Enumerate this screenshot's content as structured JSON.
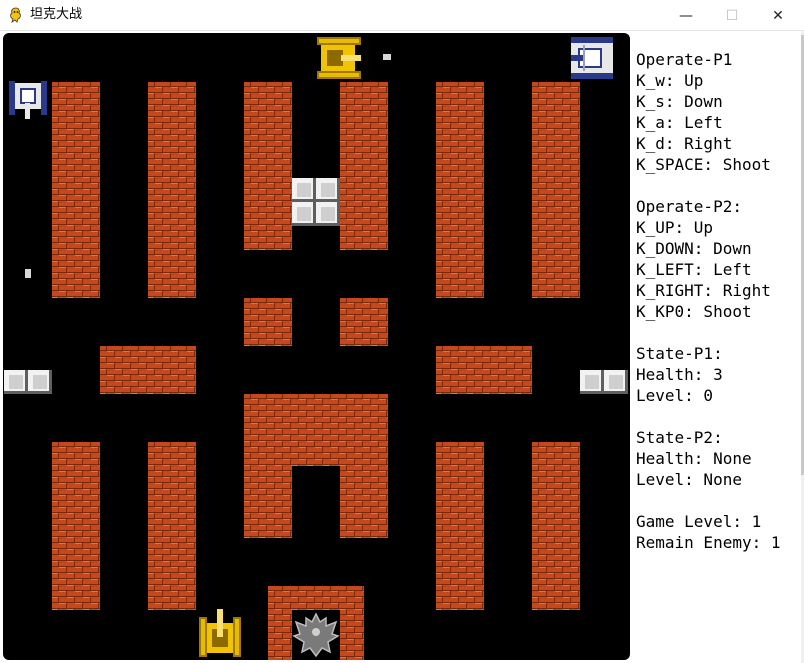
{
  "window": {
    "title": "坦克大战",
    "icon": "pygame-snake-icon",
    "controls": {
      "minimize": "—",
      "maximize": "☐",
      "close": "✕"
    }
  },
  "board": {
    "background": "#000000",
    "brick_color": "#c5471b",
    "mortar_color": "#7a2a08",
    "steel_color": "#cfcfcf",
    "player_tank_color": "#e0b000",
    "enemy_tank_color": "#e8e8e8",
    "enemy_accent_color": "#2a3a8a",
    "sprites": [
      "brick-wall",
      "steel-wall",
      "player-tank",
      "enemy-tank",
      "bonus-tank",
      "bullet",
      "eagle-base"
    ]
  },
  "side_panel": {
    "lines": [
      "Operate-P1",
      "K_w: Up",
      "K_s: Down",
      "K_a: Left",
      "K_d: Right",
      "K_SPACE: Shoot",
      "",
      "Operate-P2:",
      "K_UP: Up",
      "K_DOWN: Down",
      "K_LEFT: Left",
      "K_RIGHT: Right",
      "K_KP0: Shoot",
      "",
      "State-P1:",
      "Health: 3",
      "Level: 0",
      "",
      "State-P2:",
      "Health: None",
      "Level: None",
      "",
      "Game Level: 1",
      "Remain Enemy: 1"
    ]
  }
}
